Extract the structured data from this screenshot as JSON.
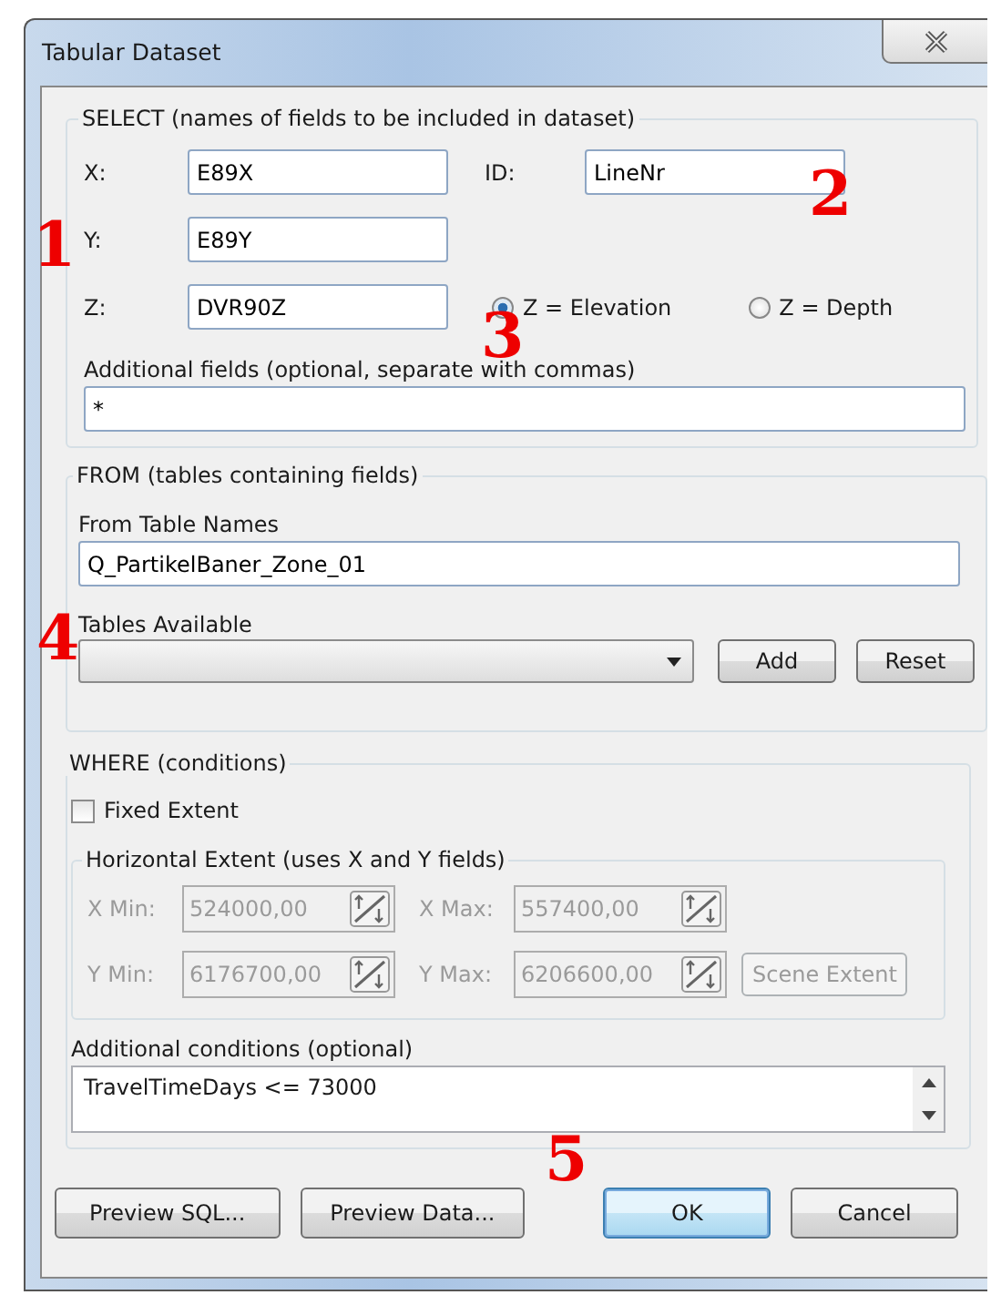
{
  "window": {
    "title": "Tabular Dataset"
  },
  "select": {
    "legend": "SELECT (names of fields to be included in dataset)",
    "fields": [
      {
        "label": "X:",
        "value": "E89X"
      },
      {
        "label": "ID:",
        "value": "LineNr"
      },
      {
        "label": "Y:",
        "value": "E89Y"
      },
      {
        "label": "Z:",
        "value": "DVR90Z"
      }
    ],
    "z_options": [
      {
        "label": "Z = Elevation",
        "selected": true
      },
      {
        "label": "Z = Depth",
        "selected": false
      }
    ],
    "additional_label": "Additional fields (optional, separate with commas)",
    "additional_value": "*"
  },
  "from": {
    "legend": "FROM (tables containing fields)",
    "table_names_label": "From Table Names",
    "table_names_value": "Q_PartikelBaner_Zone_01",
    "tables_available_label": "Tables Available",
    "buttons": [
      "Add",
      "Reset"
    ]
  },
  "where": {
    "legend": "WHERE (conditions)",
    "fixed_extent": {
      "label": "Fixed Extent",
      "checked": false
    },
    "horizontal_extent": {
      "legend": "Horizontal Extent (uses X and Y fields)",
      "disabled": true,
      "fields": [
        {
          "label": "X Min:",
          "value": "524000,00"
        },
        {
          "label": "X Max:",
          "value": "557400,00"
        },
        {
          "label": "Y Min:",
          "value": "6176700,00"
        },
        {
          "label": "Y Max:",
          "value": "6206600,00"
        }
      ],
      "scene_button": "Scene Extent"
    },
    "conditions_label": "Additional conditions (optional)",
    "conditions_value": "TravelTimeDays <= 73000"
  },
  "buttons": [
    {
      "label": "Preview SQL...",
      "default": false
    },
    {
      "label": "Preview Data...",
      "default": false
    },
    {
      "label": "OK",
      "default": true
    },
    {
      "label": "Cancel",
      "default": false
    }
  ],
  "annotations": [
    "1",
    "2",
    "3",
    "4",
    "5"
  ]
}
